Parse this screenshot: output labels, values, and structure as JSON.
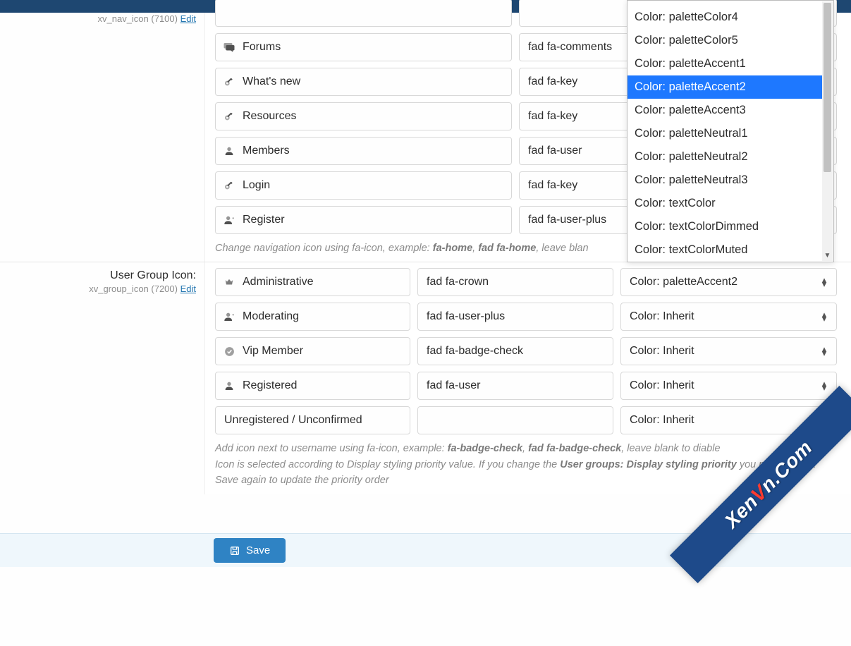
{
  "section_nav": {
    "meta": {
      "id": "xv_nav_icon (7100)",
      "edit": "Edit"
    },
    "rows": [
      {
        "icon": "comments",
        "label": "Forums",
        "value": "fad fa-comments"
      },
      {
        "icon": "key",
        "label": "What's new",
        "value": "fad fa-key"
      },
      {
        "icon": "key",
        "label": "Resources",
        "value": "fad fa-key"
      },
      {
        "icon": "user",
        "label": "Members",
        "value": "fad fa-user"
      },
      {
        "icon": "key",
        "label": "Login",
        "value": "fad fa-key"
      },
      {
        "icon": "userplus",
        "label": "Register",
        "value": "fad fa-user-plus"
      }
    ],
    "help_pre": "Change navigation icon using fa-icon, example: ",
    "help_ex1": "fa-home",
    "help_sep": ", ",
    "help_ex2": "fad fa-home",
    "help_post": ", leave blan"
  },
  "section_group": {
    "title": "User Group Icon:",
    "meta": {
      "id": "xv_group_icon (7200)",
      "edit": "Edit"
    },
    "rows": [
      {
        "icon": "crown",
        "label": "Administrative",
        "value": "fad fa-crown",
        "color": "Color: paletteAccent2"
      },
      {
        "icon": "userplus",
        "label": "Moderating",
        "value": "fad fa-user-plus",
        "color": "Color: Inherit"
      },
      {
        "icon": "badge",
        "label": "Vip Member",
        "value": "fad fa-badge-check",
        "color": "Color: Inherit"
      },
      {
        "icon": "user",
        "label": "Registered",
        "value": "fad fa-user",
        "color": "Color: Inherit"
      },
      {
        "icon": "",
        "label": "Unregistered / Unconfirmed",
        "value": "",
        "color": "Color: Inherit"
      }
    ],
    "help1_pre": "Add icon next to username using fa-icon, example: ",
    "help1_ex1": "fa-badge-check",
    "help1_sep": ", ",
    "help1_ex2": "fad fa-badge-check",
    "help1_post": ", leave blank to diable",
    "help2_pre": "Icon is selected according to Display styling priority value. If you change the ",
    "help2_bold": "User groups: Display styling priority",
    "help2_post2": " you need to click Save again to update the priority order"
  },
  "dropdown": {
    "items": [
      "Color: paletteColor4",
      "Color: paletteColor5",
      "Color: paletteAccent1",
      "Color: paletteAccent2",
      "Color: paletteAccent3",
      "Color: paletteNeutral1",
      "Color: paletteNeutral2",
      "Color: paletteNeutral3",
      "Color: textColor",
      "Color: textColorDimmed",
      "Color: textColorMuted"
    ],
    "selected_index": 3
  },
  "footer": {
    "save": "Save"
  },
  "watermark": {
    "text_pre": "Xen",
    "text_v": "V",
    "text_post": "n.Com"
  }
}
